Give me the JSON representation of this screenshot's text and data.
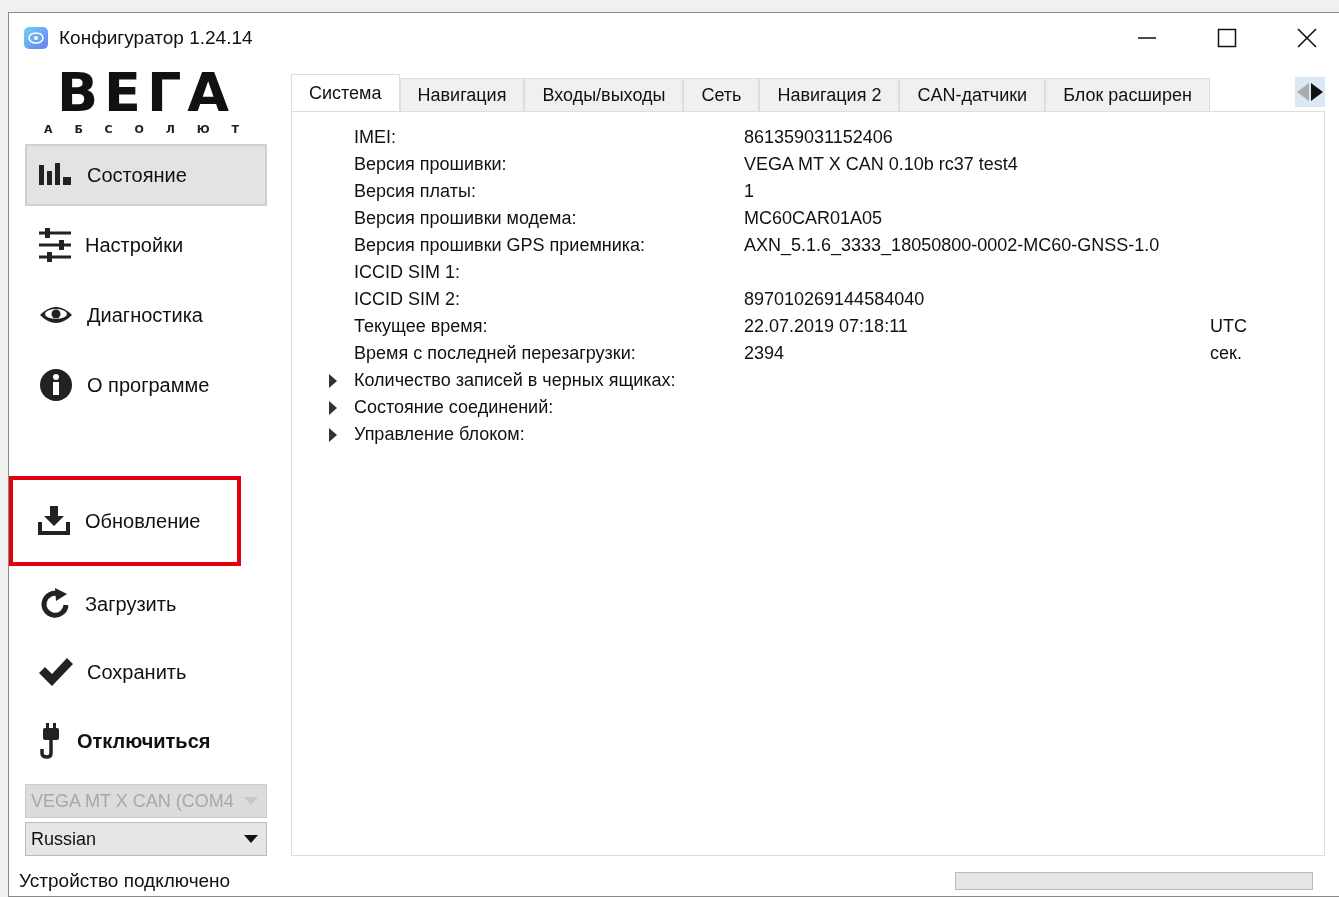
{
  "window": {
    "title": "Конфигуратор 1.24.14"
  },
  "logo": {
    "name": "ВЕГА",
    "subtitle": "А Б С О Л Ю Т"
  },
  "nav": [
    {
      "label": "Состояние",
      "kind": "chart",
      "selected": true,
      "highlighted": false
    },
    {
      "label": "Настройки",
      "kind": "sliders",
      "selected": false,
      "highlighted": false
    },
    {
      "label": "Диагностика",
      "kind": "eye",
      "selected": false,
      "highlighted": false
    },
    {
      "label": "О программе",
      "kind": "info",
      "selected": false,
      "highlighted": false
    }
  ],
  "actions": [
    {
      "label": "Обновление",
      "kind": "download",
      "highlighted": true
    },
    {
      "label": "Загрузить",
      "kind": "reload",
      "highlighted": false
    },
    {
      "label": "Сохранить",
      "kind": "check",
      "highlighted": false
    }
  ],
  "disconnect": {
    "label": "Отключиться"
  },
  "device_select": {
    "value": "VEGA MT X CAN (COM4",
    "disabled": true
  },
  "language_select": {
    "value": "Russian",
    "disabled": false
  },
  "tabs": [
    {
      "label": "Система",
      "selected": true
    },
    {
      "label": "Навигация",
      "selected": false
    },
    {
      "label": "Входы/выходы",
      "selected": false
    },
    {
      "label": "Сеть",
      "selected": false
    },
    {
      "label": "Навигация 2",
      "selected": false
    },
    {
      "label": "CAN-датчики",
      "selected": false
    },
    {
      "label": "Блок расширен",
      "selected": false
    }
  ],
  "rows": [
    {
      "label": "IMEI:",
      "value": "861359031152406"
    },
    {
      "label": "Версия прошивки:",
      "value": "VEGA MT X CAN 0.10b rc37 test4"
    },
    {
      "label": "Версия платы:",
      "value": "1"
    },
    {
      "label": "Версия прошивки модема:",
      "value": "MC60CAR01A05"
    },
    {
      "label": "Версия прошивки GPS приемника:",
      "value": "AXN_5.1.6_3333_18050800-0002-MC60-GNSS-1.0"
    },
    {
      "label": "ICCID SIM 1:"
    },
    {
      "label": "ICCID SIM 2:",
      "value": "897010269144584040"
    },
    {
      "label": "Текущее время:",
      "value": "22.07.2019 07:18:11",
      "unit": "UTC"
    },
    {
      "label": "Время с последней перезагрузки:",
      "value": "2394",
      "unit": "сек."
    }
  ],
  "groups": [
    {
      "label": "Количество записей в черных ящиках:",
      "expanded": false
    },
    {
      "label": "Состояние соединений:",
      "expanded": false
    },
    {
      "label": "Управление блоком:",
      "expanded": false
    }
  ],
  "status_bar": {
    "text": "Устройство подключено",
    "progress": {
      "level": 0
    }
  }
}
